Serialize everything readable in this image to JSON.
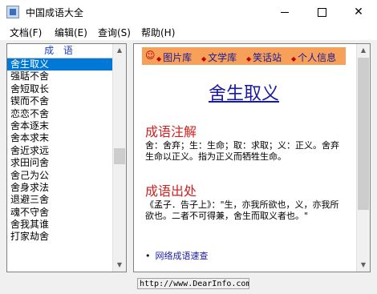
{
  "window": {
    "title": "中国成语大全",
    "minimize": "─",
    "maximize": "□",
    "close": "✕"
  },
  "menu": {
    "items": [
      "文档(F)",
      "编辑(E)",
      "查询(S)",
      "帮助(H)"
    ]
  },
  "list": {
    "header": "成 语",
    "items": [
      "舍生取义",
      "强聒不舍",
      "舍短取长",
      "锲而不舍",
      "恋恋不舍",
      "舍本逐末",
      "舍本求末",
      "舍近求远",
      "求田问舍",
      "舍己为公",
      "舍身求法",
      "退避三舍",
      "魂不守舍",
      "舍我其谁",
      "打家劫舍"
    ],
    "selected_index": 0
  },
  "content": {
    "nav": {
      "smiley": "☺",
      "links": [
        "图片库",
        "文学库",
        "笑话站",
        "个人信息"
      ]
    },
    "title": "舍生取义",
    "sections": [
      {
        "heading": "成语注解",
        "body": "舍：舍弃；生：生命；取：求取；义：正义。舍弃生命以正义。指为正义而牺牲生命。"
      },
      {
        "heading": "成语出处",
        "body": "《孟子．告子上》：\"生，亦我所欲也，义，亦我所欲也。二者不可得兼，舍生而取义者也。\""
      }
    ],
    "link": "网络成语速查"
  },
  "status": {
    "url": "http://www.DearInfo.com"
  }
}
